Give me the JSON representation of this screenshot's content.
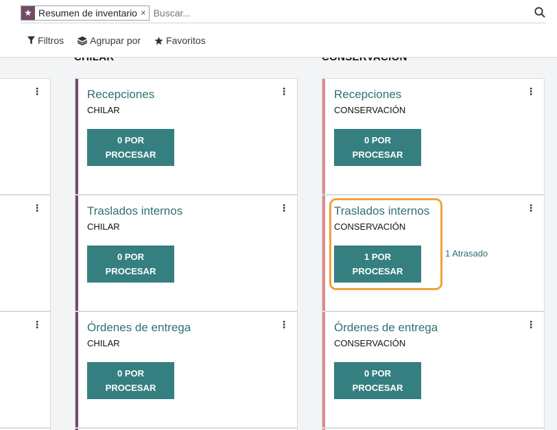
{
  "search": {
    "facet_label": "Resumen de inventario",
    "facet_remove": "×",
    "placeholder": "Buscar..."
  },
  "toolbar": {
    "filters": "Filtros",
    "group_by": "Agrupar por",
    "favorites": "Favoritos"
  },
  "groups": [
    {
      "title": "CHILAR"
    },
    {
      "title": "CONSERVACIÓN"
    }
  ],
  "columns": {
    "chilar": {
      "accent_color": "#714B67",
      "cards": [
        {
          "title": "Recepciones",
          "warehouse": "CHILAR",
          "button": [
            "0 POR",
            "PROCESAR"
          ]
        },
        {
          "title": "Traslados internos",
          "warehouse": "CHILAR",
          "button": [
            "0 POR",
            "PROCESAR"
          ]
        },
        {
          "title": "Órdenes de entrega",
          "warehouse": "CHILAR",
          "button": [
            "0 POR",
            "PROCESAR"
          ]
        }
      ]
    },
    "conservacion": {
      "accent_color": "#e08a8a",
      "cards": [
        {
          "title": "Recepciones",
          "warehouse": "CONSERVACIÓN",
          "button": [
            "0 POR",
            "PROCESAR"
          ]
        },
        {
          "title": "Traslados internos",
          "warehouse": "CONSERVACIÓN",
          "button": [
            "1 POR",
            "PROCESAR"
          ],
          "late": "1 Atrasado",
          "highlighted": true
        },
        {
          "title": "Órdenes de entrega",
          "warehouse": "CONSERVACIÓN",
          "button": [
            "0 POR",
            "PROCESAR"
          ]
        }
      ]
    }
  },
  "colors": {
    "brand": "#714B67",
    "teal_button": "#357f80",
    "link": "#2f6f73",
    "highlight": "#f0a13c"
  },
  "icons": {
    "facet": "star-icon",
    "search": "magnifier-icon",
    "filters": "funnel-icon",
    "group_by": "layers-icon",
    "favorites": "star-icon",
    "card_menu": "vertical-dots-icon"
  }
}
